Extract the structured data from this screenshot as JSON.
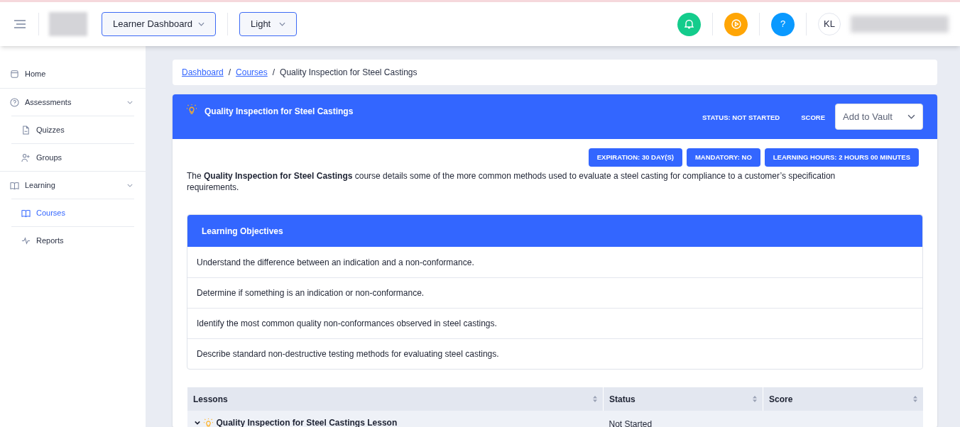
{
  "header": {
    "dashboard_select": "Learner Dashboard",
    "theme_select": "Light",
    "avatar_initials": "KL",
    "help_label": "?"
  },
  "sidebar": {
    "items": [
      {
        "label": "Home",
        "selected": false
      },
      {
        "label": "Assessments",
        "expanded": true,
        "children": [
          {
            "label": "Quizzes",
            "selected": false
          },
          {
            "label": "Groups",
            "selected": false
          }
        ]
      },
      {
        "label": "Learning",
        "expanded": true,
        "children": [
          {
            "label": "Courses",
            "selected": true
          },
          {
            "label": "Reports",
            "selected": false
          }
        ]
      }
    ]
  },
  "breadcrumb": {
    "separators": [
      "/",
      "/"
    ],
    "items": [
      {
        "label": "Dashboard",
        "link": true
      },
      {
        "label": "Courses",
        "link": true
      },
      {
        "label": "Quality Inspection for Steel Castings",
        "link": false
      }
    ]
  },
  "course": {
    "title": "Quality Inspection for Steel Castings",
    "status": "STATUS: NOT STARTED",
    "score": "SCORE",
    "vault_select": "Add to Vault",
    "badges": [
      "EXPIRATION: 30 DAY(S)",
      "MANDATORY: NO",
      "LEARNING HOURS: 2 HOURS 00 MINUTES"
    ],
    "description": "The **Quality Inspection for Steel Castings** course details some of the more common methods used to evaluate a steel casting for compliance to a customer’s specification requirements."
  },
  "objectives": {
    "title": "Learning Objectives",
    "items": [
      "Understand the difference between an indication and a non-conformance.",
      "Determine if something is an indication or non-conformance.",
      "Identify the most common quality non-conformances observed in steel castings.",
      "Describe standard non-destructive testing methods for evaluating steel castings."
    ]
  },
  "lessons": {
    "columns": [
      "Lessons",
      "Status",
      "Score"
    ],
    "rows": [
      {
        "lesson": "Quality Inspection for Steel Castings Lesson",
        "status": "Not Started",
        "expanded": true
      }
    ]
  }
}
